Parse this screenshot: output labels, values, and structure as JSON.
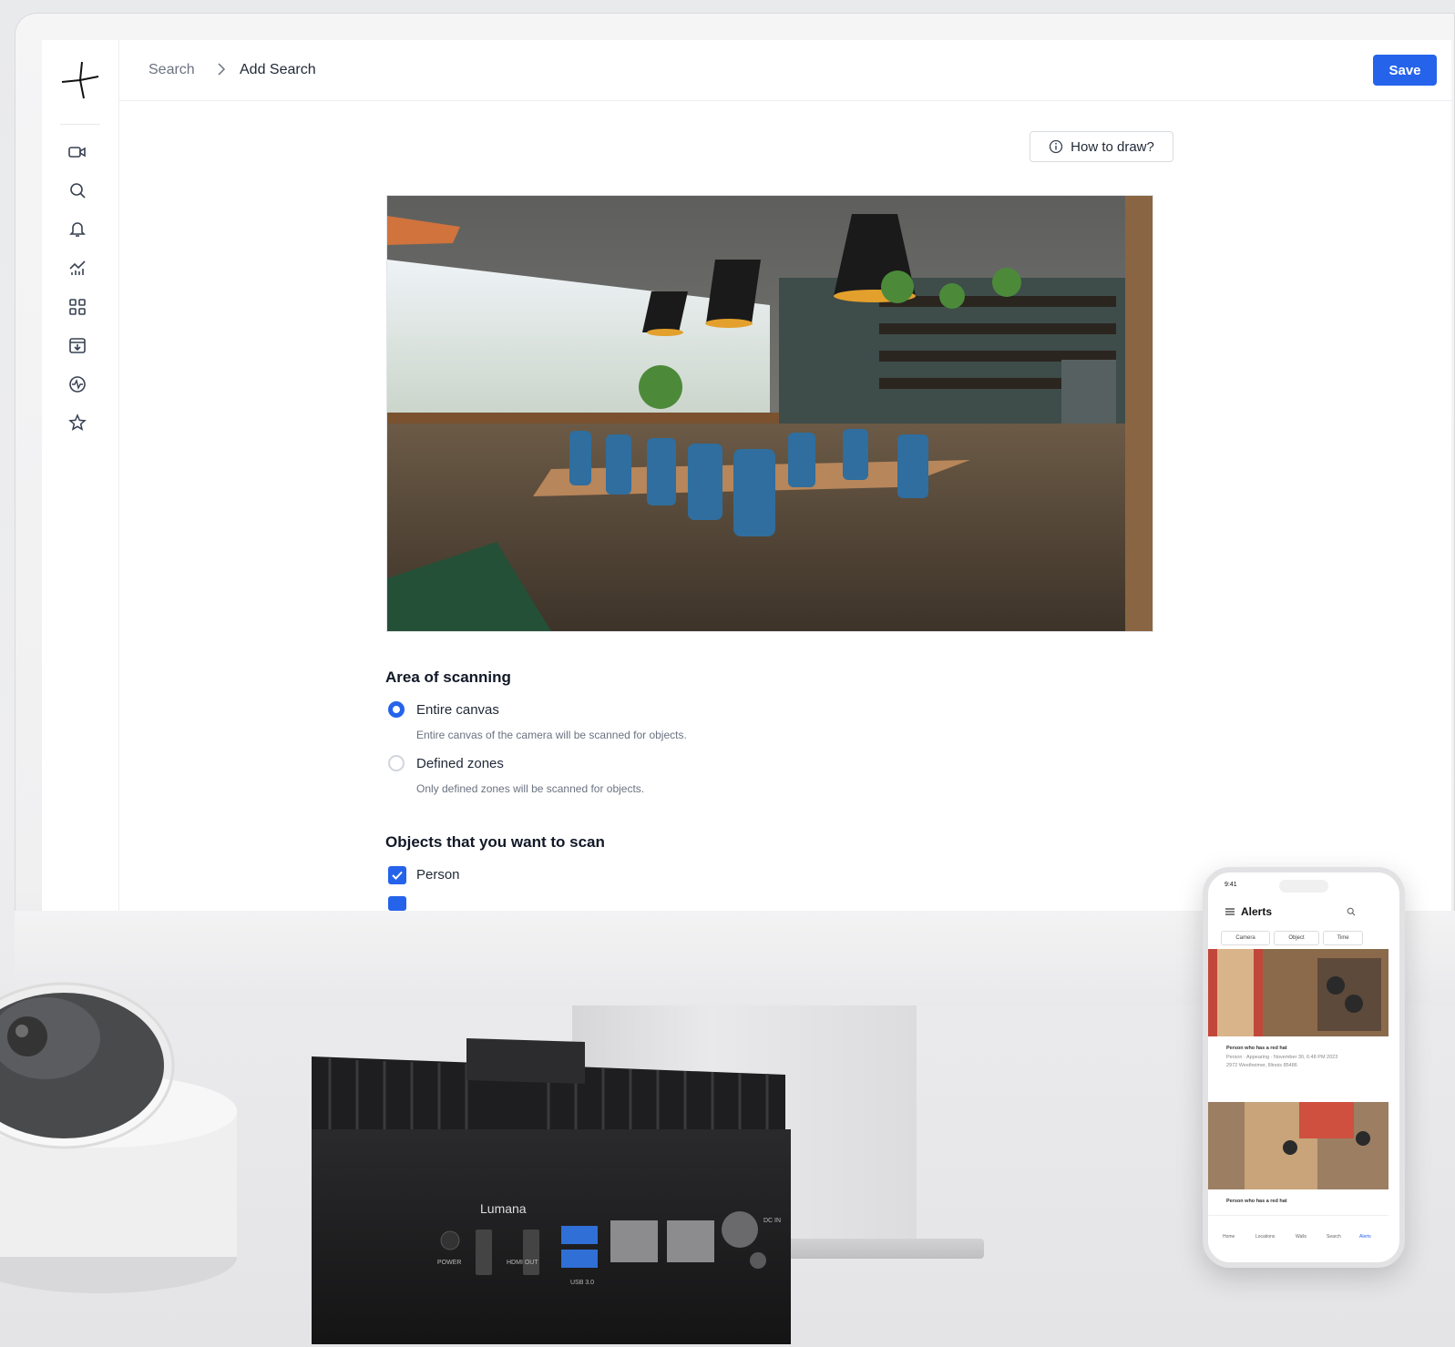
{
  "breadcrumb": {
    "parent": "Search",
    "current": "Add Search"
  },
  "toolbar": {
    "save_label": "Save",
    "howto_label": "How to draw?"
  },
  "sidebar": {
    "items": [
      {
        "name": "cameras",
        "icon": "video-camera-icon"
      },
      {
        "name": "search",
        "icon": "search-icon"
      },
      {
        "name": "alerts",
        "icon": "bell-icon"
      },
      {
        "name": "analytics",
        "icon": "chart-icon"
      },
      {
        "name": "dashboards",
        "icon": "grid-icon"
      },
      {
        "name": "archive",
        "icon": "archive-download-icon"
      },
      {
        "name": "health",
        "icon": "pulse-icon"
      },
      {
        "name": "favorites",
        "icon": "star-icon"
      }
    ]
  },
  "area": {
    "title": "Area of scanning",
    "options": [
      {
        "label": "Entire canvas",
        "help": "Entire canvas of the camera will be scanned for objects.",
        "selected": true
      },
      {
        "label": "Defined zones",
        "help": "Only defined zones will be scanned for objects.",
        "selected": false
      }
    ]
  },
  "objects": {
    "title": "Objects that you want to scan",
    "items": [
      {
        "label": "Person",
        "checked": true
      }
    ]
  },
  "phone": {
    "time": "9:41",
    "title": "Alerts",
    "filters": [
      "Camera",
      "Object",
      "Time"
    ],
    "alert1": {
      "title": "Person who has a red hat",
      "meta": "Person · Appearing · November 30, 6:48 PM 2023",
      "address": "2972 Westheimer, Illinois 85486"
    },
    "alert2": {
      "title": "Person who has a red hat"
    },
    "tabs": [
      "Home",
      "Locations",
      "Walls",
      "Search",
      "Alerts"
    ]
  },
  "device": {
    "brand": "Lumana",
    "ports": {
      "power": "POWER",
      "hdmi": "HDMI OUT",
      "usb": "USB 3.0",
      "dc": "DC IN"
    }
  },
  "colors": {
    "accent": "#2563eb",
    "text": "#1f2937",
    "muted": "#6b7280"
  }
}
